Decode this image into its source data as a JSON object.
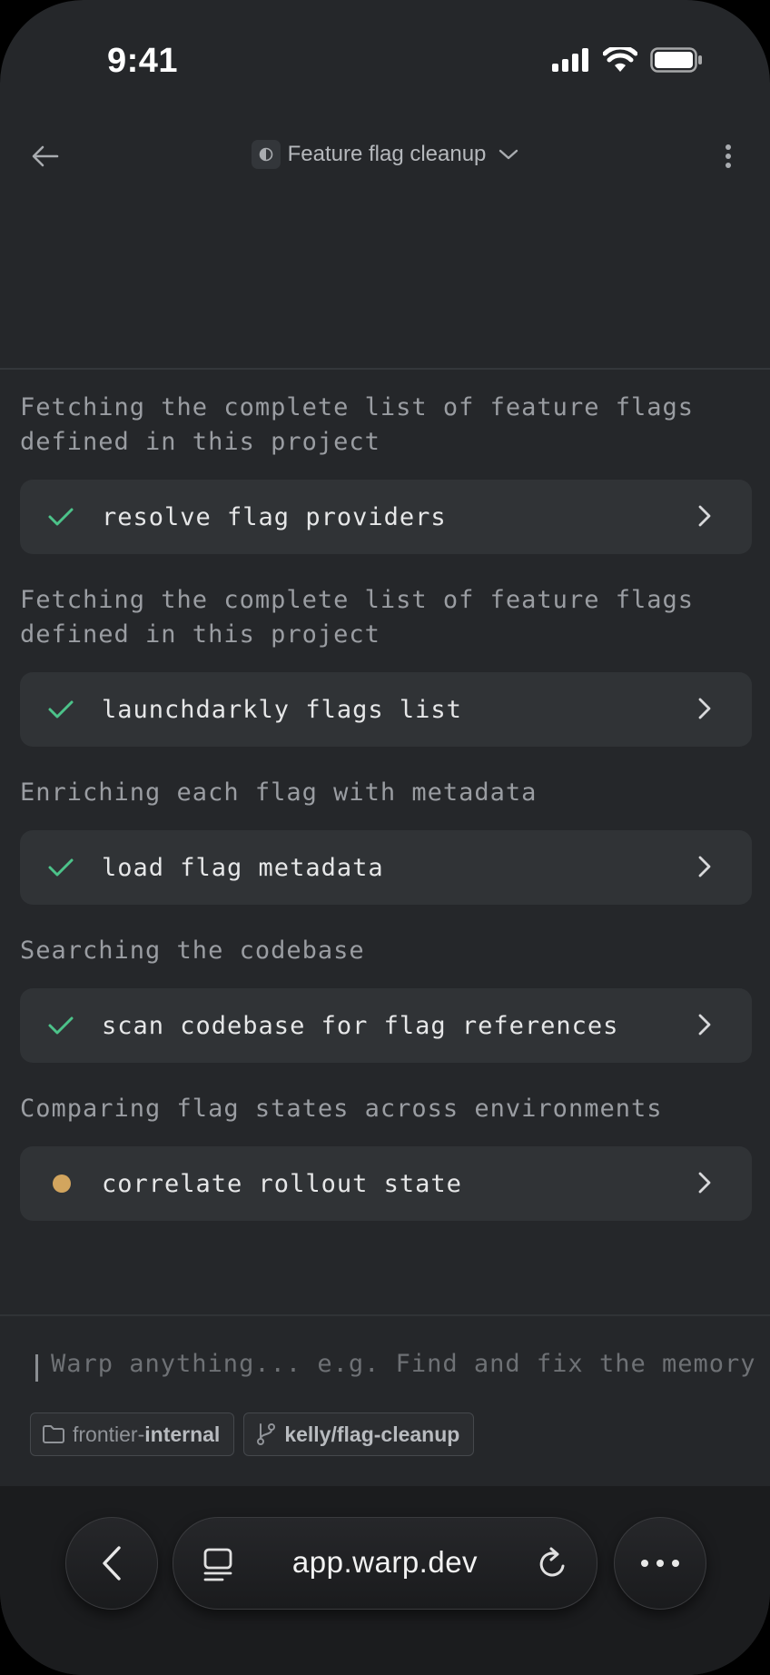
{
  "status_bar": {
    "time": "9:41"
  },
  "header": {
    "title": "Feature flag cleanup"
  },
  "steps": [
    {
      "description": "Fetching the complete list of feature flags defined in this project",
      "tool": "resolve flag providers",
      "status": "done"
    },
    {
      "description": "Fetching the complete list of feature flags defined in this project",
      "tool": "launchdarkly flags list",
      "status": "done"
    },
    {
      "description": "Enriching each flag with metadata",
      "tool": "load flag metadata",
      "status": "done"
    },
    {
      "description": "Searching the codebase",
      "tool": "scan codebase for flag references",
      "status": "done"
    },
    {
      "description": "Comparing flag states across environments",
      "tool": "correlate rollout state",
      "status": "running"
    }
  ],
  "composer": {
    "placeholder": "Warp anything... e.g. Find and fix the memory",
    "repo_prefix": "frontier-",
    "repo_name": "internal",
    "branch": "kelly/flag-cleanup"
  },
  "browser": {
    "url": "app.warp.dev"
  },
  "colors": {
    "background": "#25272a",
    "card": "#303336",
    "done": "#4cc38a",
    "running": "#d2a55e"
  }
}
